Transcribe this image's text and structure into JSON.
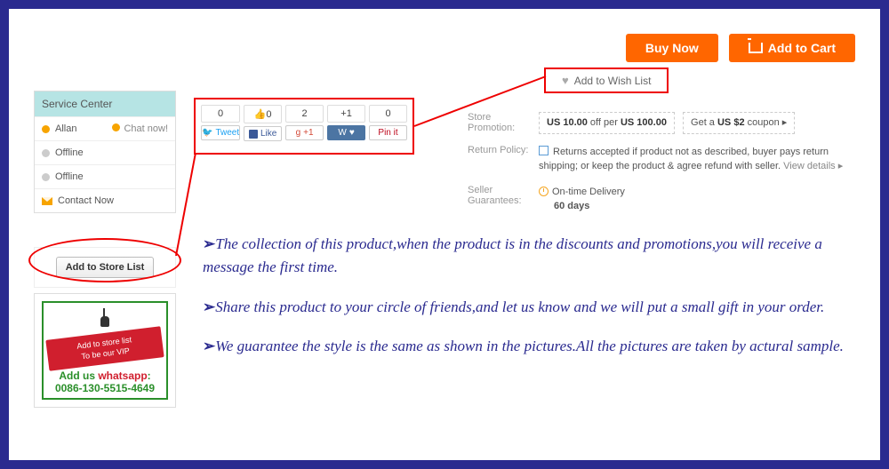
{
  "top": {
    "buy": "Buy Now",
    "cart": "Add to Cart",
    "wish": "Add to Wish List"
  },
  "service": {
    "header": "Service Center",
    "rows": [
      {
        "name": "Allan",
        "badge": "Chat now!",
        "status": "online"
      },
      {
        "name": "Offline",
        "badge": "",
        "status": "offline"
      },
      {
        "name": "Offline",
        "badge": "",
        "status": "offline"
      }
    ],
    "contact": "Contact Now"
  },
  "store_button": "Add to Store List",
  "promo_card": {
    "tag_line1": "Add to store list",
    "tag_line2": "To be our VIP",
    "line1_a": "Add us ",
    "line1_b": "whatsapp",
    "line1_c": ":",
    "phone": "0086-130-5515-4649"
  },
  "share": {
    "items": [
      {
        "count": "0",
        "label": "Tweet",
        "cls": "tw",
        "glyph": "🐦"
      },
      {
        "count": "0",
        "label": "Like",
        "cls": "fb",
        "glyph": "",
        "thumb": true
      },
      {
        "count": "2",
        "label": "+1",
        "cls": "g",
        "glyph": "g"
      },
      {
        "count": "+1",
        "label": "",
        "cls": "vk",
        "glyph": "W ♥"
      },
      {
        "count": "0",
        "label": "Pin it",
        "cls": "pin",
        "glyph": ""
      }
    ],
    "fb_count_thumb": "👍0"
  },
  "info": {
    "promo_label": "Store Promotion:",
    "promo_pill1_a": "US 10.00 ",
    "promo_pill1_b": "off per ",
    "promo_pill1_c": "US 100.00",
    "promo_pill2_a": "Get a ",
    "promo_pill2_b": "US $2 ",
    "promo_pill2_c": "coupon ▸",
    "return_label": "Return Policy:",
    "return_text": "Returns accepted if product not as described, buyer pays return shipping; or keep the product & agree refund with seller. ",
    "return_link": "View details ▸",
    "guar_label_a": "Seller",
    "guar_label_b": "Guarantees:",
    "guar_t1": "On-time Delivery",
    "guar_t2": "60 days"
  },
  "notes": {
    "p1": "The collection of this product,when the product is in the discounts and promotions,you will receive a message the first time.",
    "p2": "Share this product to your circle of friends,and let us know and we will put a small gift in your order.",
    "p3": "We guarantee the style is the same as shown in the pictures.All the pictures are taken by actural sample."
  }
}
